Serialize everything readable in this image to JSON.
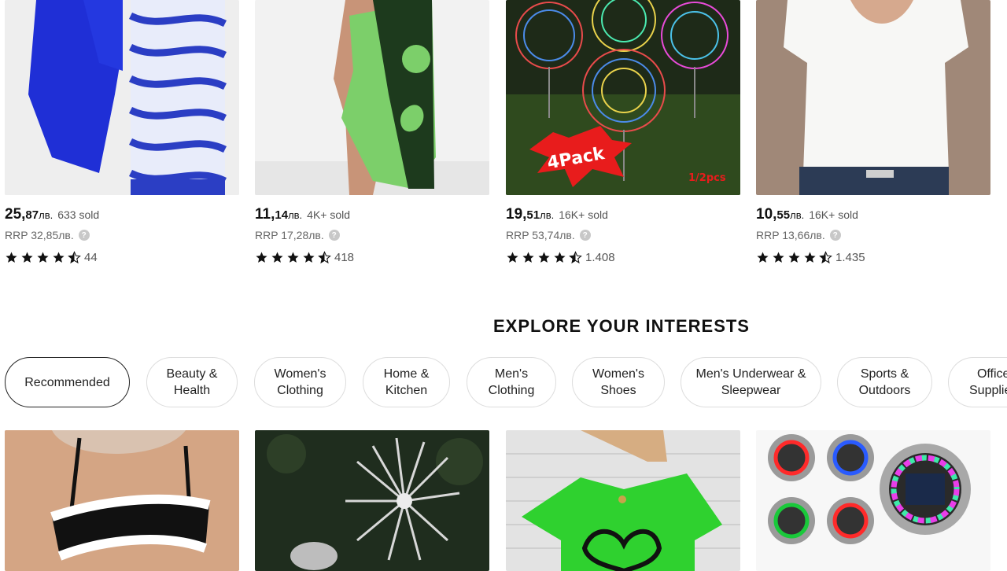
{
  "products_top": [
    {
      "price_main": "25,",
      "price_cents": "87",
      "currency": "лв.",
      "sold": "633 sold",
      "rrp": "RRP 32,85лв.",
      "reviews": "44"
    },
    {
      "price_main": "11,",
      "price_cents": "14",
      "currency": "лв.",
      "sold": "4K+ sold",
      "rrp": "RRP 17,28лв.",
      "reviews": "418"
    },
    {
      "price_main": "19,",
      "price_cents": "51",
      "currency": "лв.",
      "sold": "16K+ sold",
      "rrp": "RRP 53,74лв.",
      "reviews": "1.408",
      "badge": "4Pack",
      "badge_sub": "1/2pcs"
    },
    {
      "price_main": "10,",
      "price_cents": "55",
      "currency": "лв.",
      "sold": "16K+ sold",
      "rrp": "RRP 13,66лв.",
      "reviews": "1.435"
    }
  ],
  "section": {
    "title": "EXPLORE YOUR INTERESTS"
  },
  "chips": [
    {
      "label": "Recommended",
      "active": true
    },
    {
      "label": "Beauty & Health"
    },
    {
      "label": "Women's Clothing"
    },
    {
      "label": "Home & Kitchen"
    },
    {
      "label": "Men's Clothing"
    },
    {
      "label": "Women's Shoes"
    },
    {
      "label": "Men's Underwear & Sleepwear"
    },
    {
      "label": "Sports & Outdoors"
    },
    {
      "label": "Office Supplies"
    }
  ],
  "colors": {
    "star": "#111111",
    "chip_border": "#dddddd",
    "active_border": "#222222"
  }
}
